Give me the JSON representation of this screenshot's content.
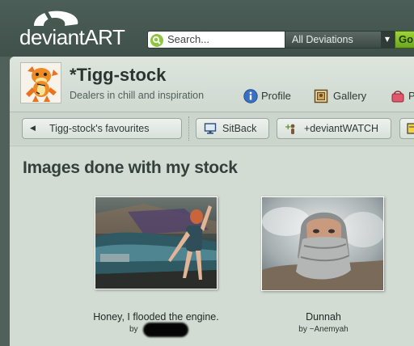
{
  "header": {
    "logo_text": "deviantART",
    "search_placeholder": "Search...",
    "scope_label": "All Deviations",
    "go_label": "Go"
  },
  "profile": {
    "username": "*Tigg-stock",
    "tagline": "Dealers in chill and inspiration",
    "nav": [
      {
        "label": "Profile",
        "icon": "info-icon"
      },
      {
        "label": "Gallery",
        "icon": "gallery-icon"
      },
      {
        "label": "P",
        "icon": "prints-icon"
      }
    ]
  },
  "toolbar": {
    "back_label": "Tigg-stock's favourites",
    "sitback_label": "SitBack",
    "watch_label": "+deviantWATCH"
  },
  "section": {
    "title": "Images done with my stock"
  },
  "items": [
    {
      "title": "Honey, I flooded the engine.",
      "by_prefix": "by",
      "author": ""
    },
    {
      "title": "Dunnah",
      "by_prefix": "by",
      "author": "~Anemyah"
    }
  ],
  "colors": {
    "header_bg": "#46574f",
    "panel_bg": "#d3dcd3",
    "accent_green": "#8dc63f",
    "title_text": "#34403b"
  }
}
